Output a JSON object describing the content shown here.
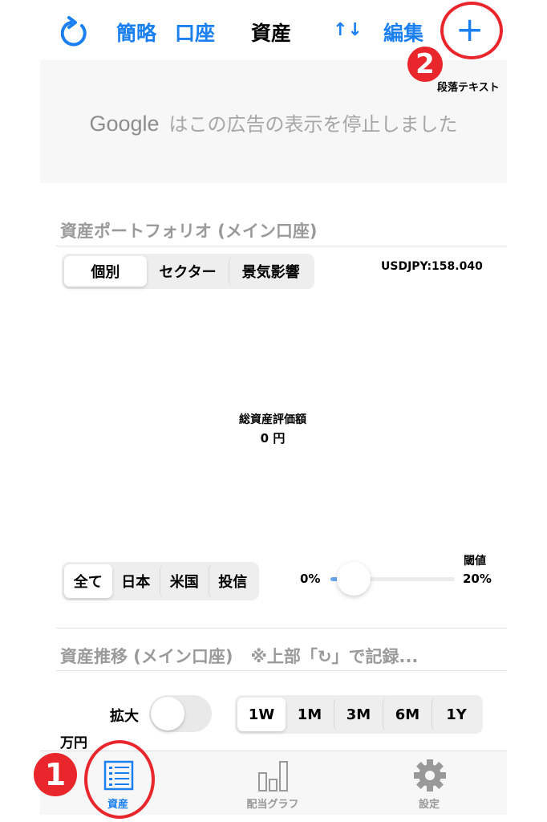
{
  "header": {
    "simple": "簡略",
    "account": "口座",
    "title": "資産",
    "sort": "↑↓",
    "edit": "編集",
    "add": "+"
  },
  "annotation": {
    "badge1": "1",
    "badge2": "2",
    "note": "段落テキスト"
  },
  "ad": {
    "brand": "Google",
    "message": "はこの広告の表示を停止しました"
  },
  "portfolio": {
    "title": "資産ポートフォリオ (メイン口座)",
    "tabs": [
      "個別",
      "セクター",
      "景気影響"
    ],
    "selected": 0,
    "fx": "USDJPY:158.040",
    "total_label": "総資産評価額",
    "total_value": "0 円"
  },
  "filter": {
    "tabs": [
      "全て",
      "日本",
      "米国",
      "投信"
    ],
    "selected": 0,
    "threshold_label": "閾値",
    "min": "0%",
    "max": "20%",
    "value_fraction": 0.0
  },
  "history": {
    "title": "資産推移 (メイン口座)",
    "note": "※上部「↻」で記録...",
    "zoom_label": "拡大",
    "zoom_on": false,
    "ranges": [
      "1W",
      "1M",
      "3M",
      "6M",
      "1Y"
    ],
    "selected": 0,
    "unit": "万円"
  },
  "tabbar": {
    "items": [
      {
        "label": "資産",
        "active": true
      },
      {
        "label": "配当グラフ",
        "active": false
      },
      {
        "label": "設定",
        "active": false
      }
    ]
  },
  "colors": {
    "accent": "#1a7ff0",
    "annotation": "#e8262b"
  }
}
